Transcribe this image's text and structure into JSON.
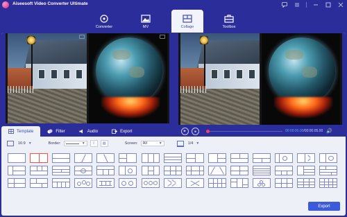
{
  "app": {
    "title": "Aiseesoft Video Converter Ultimate"
  },
  "window_controls": [
    "chat-icon",
    "menu-icon",
    "minimize-icon",
    "maximize-icon",
    "close-icon"
  ],
  "top_nav": {
    "tabs": [
      {
        "label": "Converter",
        "icon": "converter-icon"
      },
      {
        "label": "MV",
        "icon": "mv-icon"
      },
      {
        "label": "Collage",
        "icon": "collage-icon",
        "active": true
      },
      {
        "label": "Toolbox",
        "icon": "toolbox-icon"
      }
    ]
  },
  "sub_tabs": [
    {
      "label": "Template",
      "icon": "template-icon",
      "active": true
    },
    {
      "label": "Filter",
      "icon": "filter-icon"
    },
    {
      "label": "Audio",
      "icon": "audio-icon"
    },
    {
      "label": "Export",
      "icon": "export-icon"
    }
  ],
  "player": {
    "current_time": "00:00:00.00",
    "total_time": "/00:00:05.00"
  },
  "toolbar": {
    "aspect_ratio": "16:9",
    "border_label": "Border:",
    "screen_label": "Screen:",
    "screen_value": "All",
    "page": "1/4"
  },
  "export_button": "Export",
  "colors": {
    "window_bg": "#2b2e9a",
    "panel_bg": "#eef0f8",
    "accent": "#3b5bdb",
    "template_stroke": "#7c86da",
    "selected_template": "#ff4a3c",
    "progress_dot": "#ff3b5b"
  }
}
